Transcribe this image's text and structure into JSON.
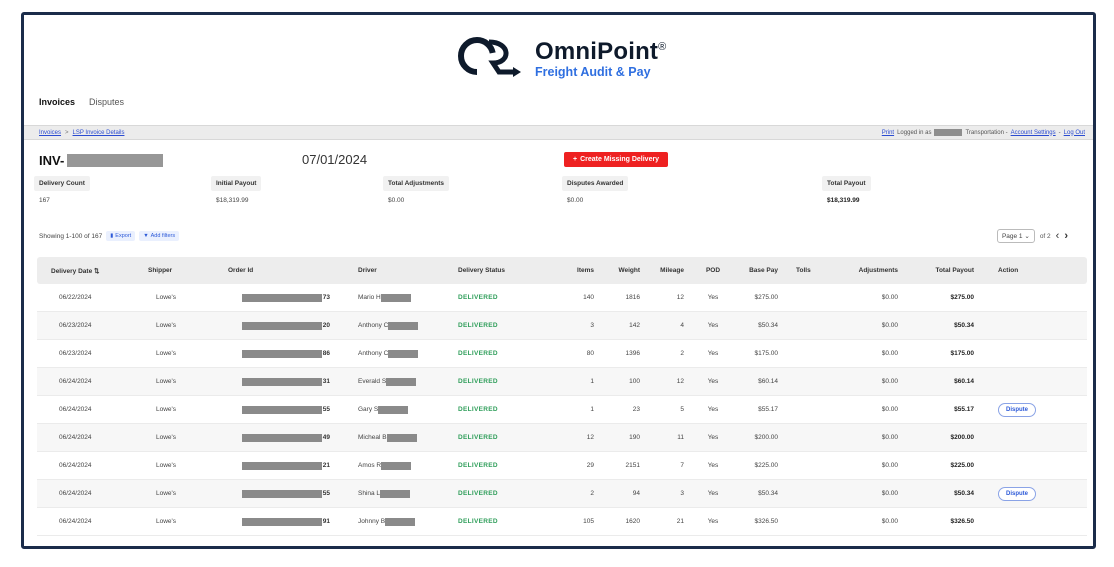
{
  "brand": {
    "name": "OmniPoint",
    "mark": "®",
    "tagline": "Freight Audit & Pay"
  },
  "tabs": [
    {
      "label": "Invoices",
      "active": true
    },
    {
      "label": "Disputes",
      "active": false
    }
  ],
  "breadcrumb": {
    "items": [
      "Invoices",
      "LSP Invoice Details"
    ],
    "separator": ">"
  },
  "subbar": {
    "print": "Print",
    "logged_in_prefix": "Logged in as",
    "logged_in_suffix": "Transportation -",
    "account_settings": "Account Settings",
    "dash": "-",
    "log_out": "Log Out"
  },
  "invoice": {
    "prefix": "INV-",
    "date": "07/01/2024",
    "create_button": "Create Missing Delivery"
  },
  "stats": [
    {
      "label": "Delivery Count",
      "value": "167"
    },
    {
      "label": "Initial Payout",
      "value": "$18,319.99"
    },
    {
      "label": "Total Adjustments",
      "value": "$0.00"
    },
    {
      "label": "Disputes Awarded",
      "value": "$0.00"
    },
    {
      "label": "Total Payout",
      "value": "$18,319.99"
    }
  ],
  "controls": {
    "showing": "Showing 1-100 of 167",
    "export": "Export",
    "add_filters": "Add filters",
    "page_select": "Page 1",
    "of_pages": "of 2"
  },
  "table": {
    "headers": [
      "Delivery Date",
      "Shipper",
      "Order Id",
      "Driver",
      "Delivery Status",
      "Items",
      "Weight",
      "Mileage",
      "POD",
      "Base Pay",
      "Tolls",
      "Adjustments",
      "Total Payout",
      "Action"
    ],
    "rows": [
      {
        "date": "06/22/2024",
        "shipper": "Lowe's",
        "order_suffix": "73",
        "driver": "Mario H",
        "status": "DELIVERED",
        "items": "140",
        "weight": "1816",
        "mileage": "12",
        "pod": "Yes",
        "base": "$275.00",
        "tolls": "",
        "adj": "$0.00",
        "total": "$275.00",
        "action": ""
      },
      {
        "date": "06/23/2024",
        "shipper": "Lowe's",
        "order_suffix": "20",
        "driver": "Anthony C",
        "status": "DELIVERED",
        "items": "3",
        "weight": "142",
        "mileage": "4",
        "pod": "Yes",
        "base": "$50.34",
        "tolls": "",
        "adj": "$0.00",
        "total": "$50.34",
        "action": ""
      },
      {
        "date": "06/23/2024",
        "shipper": "Lowe's",
        "order_suffix": "86",
        "driver": "Anthony C",
        "status": "DELIVERED",
        "items": "80",
        "weight": "1396",
        "mileage": "2",
        "pod": "Yes",
        "base": "$175.00",
        "tolls": "",
        "adj": "$0.00",
        "total": "$175.00",
        "action": ""
      },
      {
        "date": "06/24/2024",
        "shipper": "Lowe's",
        "order_suffix": "31",
        "driver": "Everald S",
        "status": "DELIVERED",
        "items": "1",
        "weight": "100",
        "mileage": "12",
        "pod": "Yes",
        "base": "$60.14",
        "tolls": "",
        "adj": "$0.00",
        "total": "$60.14",
        "action": ""
      },
      {
        "date": "06/24/2024",
        "shipper": "Lowe's",
        "order_suffix": "55",
        "driver": "Gary S",
        "status": "DELIVERED",
        "items": "1",
        "weight": "23",
        "mileage": "5",
        "pod": "Yes",
        "base": "$55.17",
        "tolls": "",
        "adj": "$0.00",
        "total": "$55.17",
        "action": "Dispute"
      },
      {
        "date": "06/24/2024",
        "shipper": "Lowe's",
        "order_suffix": "49",
        "driver": "Micheal B",
        "status": "DELIVERED",
        "items": "12",
        "weight": "190",
        "mileage": "11",
        "pod": "Yes",
        "base": "$200.00",
        "tolls": "",
        "adj": "$0.00",
        "total": "$200.00",
        "action": ""
      },
      {
        "date": "06/24/2024",
        "shipper": "Lowe's",
        "order_suffix": "21",
        "driver": "Amos R",
        "status": "DELIVERED",
        "items": "29",
        "weight": "2151",
        "mileage": "7",
        "pod": "Yes",
        "base": "$225.00",
        "tolls": "",
        "adj": "$0.00",
        "total": "$225.00",
        "action": ""
      },
      {
        "date": "06/24/2024",
        "shipper": "Lowe's",
        "order_suffix": "55",
        "driver": "Shina L",
        "status": "DELIVERED",
        "items": "2",
        "weight": "94",
        "mileage": "3",
        "pod": "Yes",
        "base": "$50.34",
        "tolls": "",
        "adj": "$0.00",
        "total": "$50.34",
        "action": "Dispute"
      },
      {
        "date": "06/24/2024",
        "shipper": "Lowe's",
        "order_suffix": "91",
        "driver": "Johnny B",
        "status": "DELIVERED",
        "items": "105",
        "weight": "1620",
        "mileage": "21",
        "pod": "Yes",
        "base": "$326.50",
        "tolls": "",
        "adj": "$0.00",
        "total": "$326.50",
        "action": ""
      }
    ]
  },
  "colors": {
    "accent": "#2f6fe0",
    "danger": "#ee2121",
    "delivered": "#2f9e5a",
    "frame": "#1b2c4a"
  }
}
